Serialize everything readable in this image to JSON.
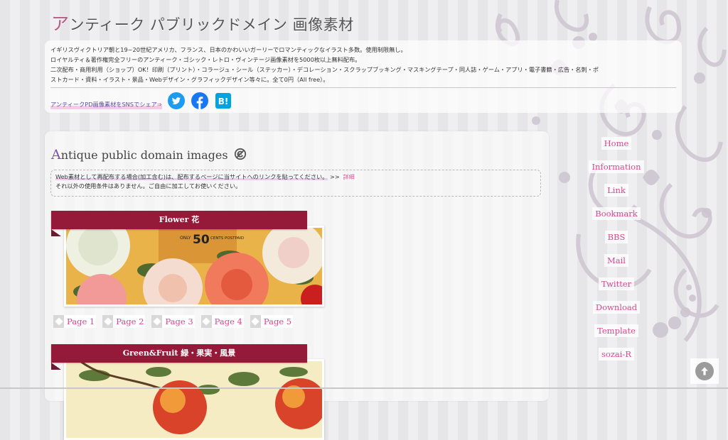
{
  "header": {
    "title_first": "ア",
    "title_rest": "ンティーク パブリックドメイン 画像素材"
  },
  "intro": {
    "lines": [
      "イギリスヴィクトリア朝と19~20世紀アメリカ、フランス、日本のかわいいガーリーでロマンティックなイラスト多数。使用制限無し。",
      "ロイヤルティ＆著作権完全フリーのアンティーク・ゴシック・レトロ・ヴィンテージ画像素材を5000枚以上無料配布。",
      "二次配布・商用利用（ショップ）OK！印刷（プリント）・コラージュ・シール（ステッカー）・デコレーション・スクラップブッキング・マスキングテープ・同人誌・ゲーム・アプリ・電子書籍・広告・名刺・ポ",
      "ストカード・資料・イラスト・景品・Webデザイン・グラフィックデザイン等々に。全て0円（All free）。"
    ],
    "share_text": "アンティークPD画像素材をSNSでシェア",
    "share_arrow": "⇒",
    "sns": [
      {
        "name": "twitter",
        "color": "#1d9bf0"
      },
      {
        "name": "facebook",
        "color": "#1877f2"
      },
      {
        "name": "hatena-bookmark",
        "color": "#00a4de",
        "label": "B!"
      }
    ]
  },
  "main": {
    "section_title_first": "A",
    "section_title_rest": "ntique public domain images",
    "notice": {
      "line1": "Web素材として再配布する場合(加工含む)は、配布するページに当サイトへのリンクを貼ってください。",
      "line1_suffix": ">>",
      "detail_link": "詳細",
      "line2": "それ以外の使用条件はありません。ご自由に加工してお使いください。"
    },
    "categories": [
      {
        "title": "Flower 花",
        "image_caption": "ONLY 50 CENTS POSTPAID",
        "price": "50",
        "pre": "ONLY",
        "post": "CENTS POSTPAID"
      },
      {
        "title": "Green&Fruit 緑・果実・風景"
      }
    ],
    "pages": [
      "Page 1",
      "Page 2",
      "Page 3",
      "Page 4",
      "Page 5"
    ]
  },
  "nav": {
    "items": [
      "Home",
      "Information",
      "Link",
      "Bookmark",
      "BBS",
      "Mail",
      "Twitter",
      "Download",
      "Template",
      "sozai-R"
    ]
  },
  "colors": {
    "accent_pink": "#d9478e",
    "banner": "#951a39",
    "title_accent": "#b75a86",
    "section_accent": "#7a55b0"
  }
}
